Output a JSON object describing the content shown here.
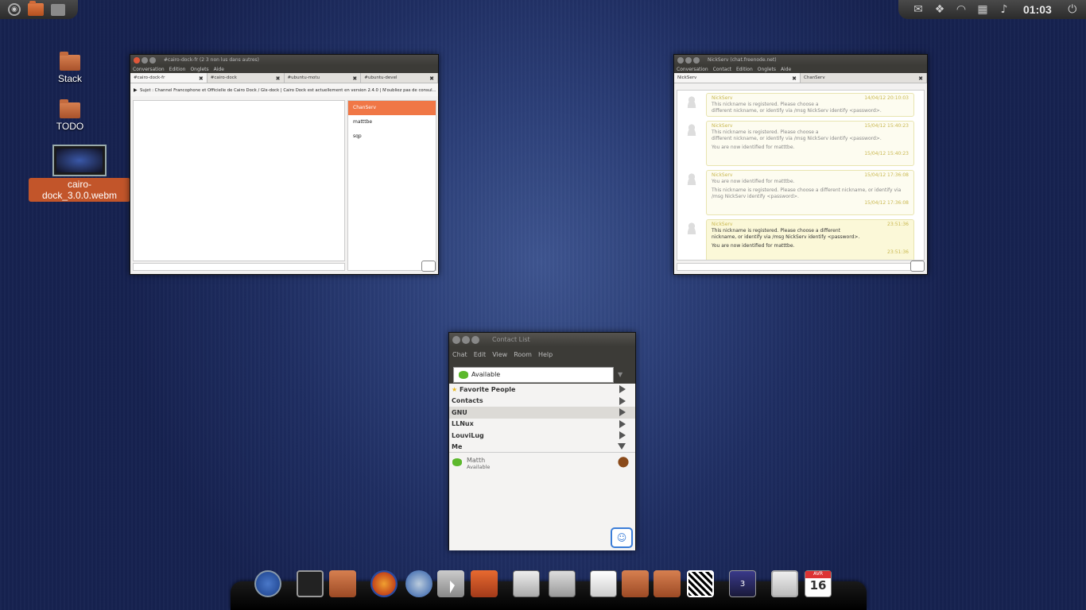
{
  "topbar": {
    "clock": "01:03"
  },
  "desktop": {
    "icons": [
      {
        "label": "Stack"
      },
      {
        "label": "TODO"
      },
      {
        "label": "cairo-dock_3.0.0.webm"
      }
    ]
  },
  "irc_window": {
    "title": "#cairo-dock-fr (2 3 non lus dans autres)",
    "menu": [
      "Conversation",
      "Edition",
      "Onglets",
      "Aide"
    ],
    "tabs": [
      "#cairo-dock-fr",
      "#cairo-dock",
      "#ubuntu-motu",
      "#ubuntu-devel"
    ],
    "topic": "Sujet : Channel Francophone et Officielle de Cairo Dock / Glx-dock | Cairo Dock est actuellement en version 2.4.0 | N'oubliez pas de consul...",
    "members": [
      "ChanServ",
      "matttbe",
      "sqp"
    ]
  },
  "nickserv_window": {
    "title": "NickServ (chat.freenode.net)",
    "menu": [
      "Conversation",
      "Contact",
      "Edition",
      "Onglets",
      "Aide"
    ],
    "tabs": [
      "NickServ",
      "ChanServ"
    ],
    "messages": [
      {
        "sender": "NickServ",
        "time": "14/04/12 20:10:03",
        "lines": [
          "This nickname is registered. Please choose a",
          "different nickname, or identify via /msg NickServ identify <password>."
        ],
        "sub": "",
        "subtime": ""
      },
      {
        "sender": "NickServ",
        "time": "15/04/12 15:40:23",
        "lines": [
          "This nickname is registered. Please choose a",
          "different nickname, or identify via /msg NickServ identify <password>."
        ],
        "sub": "You are now identified for matttbe.",
        "subtime": "15/04/12 15:40:23"
      },
      {
        "sender": "NickServ",
        "time": "15/04/12 17:36:08",
        "lines": [
          "You are now identified for matttbe."
        ],
        "sub": "This nickname is registered. Please choose a different nickname, or identify via /msg NickServ identify <password>.",
        "subtime": "15/04/12 17:36:08"
      },
      {
        "sender": "NickServ",
        "time": "23:51:36",
        "lines": [
          "This nickname is registered. Please choose a different",
          "nickname, or identify via /msg NickServ identify <password>."
        ],
        "sub": "You are now identified for matttbe.",
        "subtime": "23:51:36"
      }
    ]
  },
  "contact_list": {
    "title": "Contact List",
    "menu": [
      "Chat",
      "Edit",
      "View",
      "Room",
      "Help"
    ],
    "presence": "Available",
    "groups": [
      "Favorite People",
      "Contacts",
      "GNU",
      "LLNux",
      "LouviLug",
      "Me"
    ],
    "contact": {
      "name": "Matth",
      "status": "Available"
    }
  },
  "dock": {
    "calendar_month": "AVR",
    "calendar_day": "16",
    "badge": "3"
  }
}
